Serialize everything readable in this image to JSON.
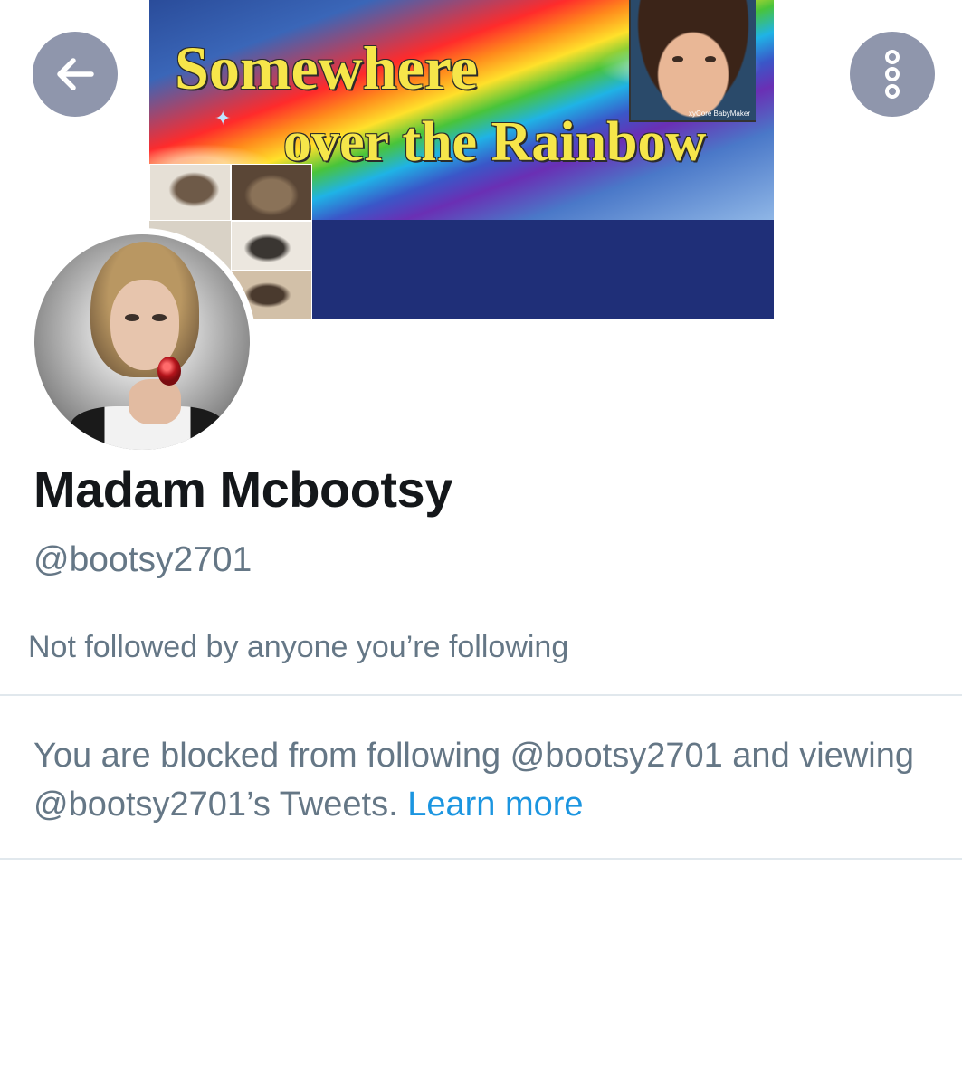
{
  "header": {
    "banner_title_line1": "Somewhere",
    "banner_title_line2": "over the Rainbow",
    "banner_watermark": "xyCore BabyMaker",
    "back_icon": "arrow-left-icon",
    "more_icon": "more-vertical-icon"
  },
  "profile": {
    "display_name": "Madam Mcbootsy",
    "handle": "@bootsy2701",
    "followed_by": "Not followed by anyone you’re following"
  },
  "blocked_notice": {
    "message": "You are blocked from following @bootsy2701 and viewing @bootsy2701’s Tweets.",
    "link_label": "Learn more",
    "link_color": "#1b95e0"
  },
  "colors": {
    "button_bg": "#8f96ac",
    "secondary_text": "#657786",
    "primary_text": "#14171a",
    "divider": "#e1e8ed",
    "banner_bg": "#1f2f78"
  }
}
